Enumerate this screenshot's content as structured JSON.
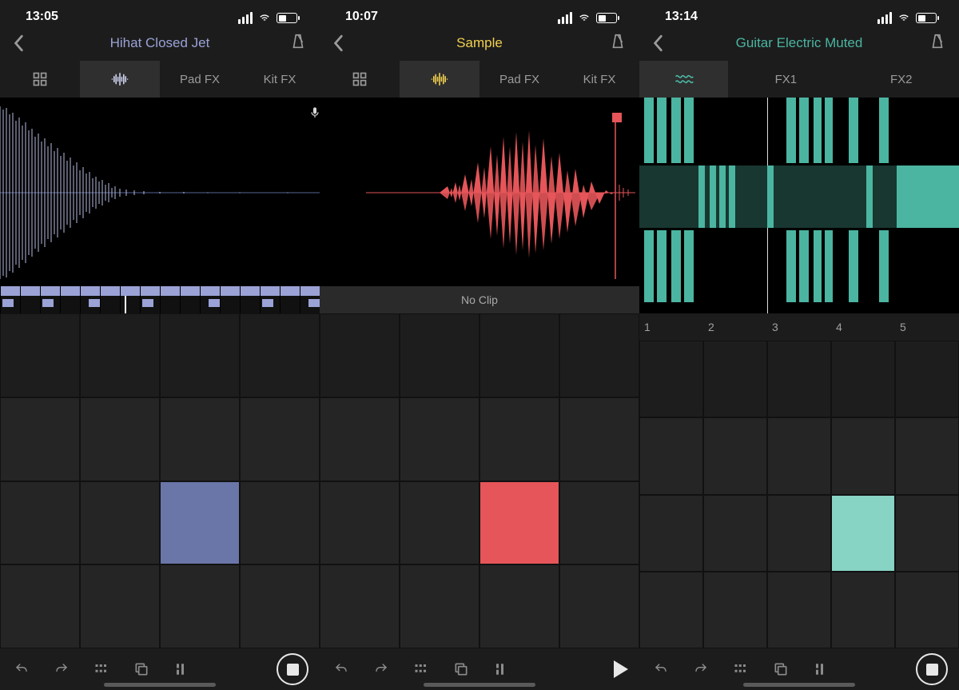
{
  "screens": [
    {
      "time": "13:05",
      "title": "Hihat Closed Jet",
      "accent": "#9aa2d6",
      "tabs": [
        "grid",
        "wave",
        "Pad FX",
        "Kit FX"
      ],
      "activeTab": 1,
      "showMic": true,
      "pad": {
        "cols": 4,
        "rows": 4,
        "selected": [
          2,
          2
        ],
        "selColor": "#6a75a8"
      },
      "transport": "stop"
    },
    {
      "time": "10:07",
      "title": "Sample",
      "accent": "#f2d04f",
      "tabs": [
        "grid",
        "wave",
        "Pad FX",
        "Kit FX"
      ],
      "activeTab": 1,
      "clipLabel": "No Clip",
      "pad": {
        "cols": 4,
        "rows": 4,
        "selected": [
          2,
          2
        ],
        "selColor": "#e55559"
      },
      "transport": "play"
    },
    {
      "time": "13:14",
      "title": "Guitar Electric Muted",
      "accent": "#4bb5a1",
      "tabs": [
        "waves",
        "FX1",
        "FX2"
      ],
      "activeTab": 0,
      "barNumbers": [
        "1",
        "2",
        "3",
        "4",
        "5"
      ],
      "pad": {
        "cols": 5,
        "rows": 4,
        "selected": [
          2,
          3
        ],
        "selColor": "#87d3c4"
      },
      "transport": "stop"
    }
  ],
  "icons": {
    "back": "‹"
  },
  "toolbar": [
    "undo",
    "redo",
    "grid",
    "copy",
    "align"
  ]
}
